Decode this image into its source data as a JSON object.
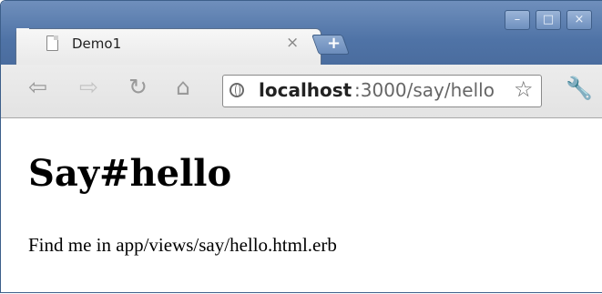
{
  "browser": {
    "tab": {
      "title": "Demo1",
      "close_glyph": "×"
    },
    "new_tab_glyph": "+",
    "window_buttons": {
      "minimize": "–",
      "maximize": "□",
      "close": "×"
    },
    "nav": {
      "back": "⇦",
      "forward": "⇨",
      "reload": "↻",
      "home": "⌂"
    },
    "address": {
      "host": "localhost",
      "path": ":3000/say/hello",
      "icon": "globe-icon"
    },
    "bookmark_glyph": "☆",
    "menu_glyph": "🔧"
  },
  "page": {
    "heading": "Say#hello",
    "text": "Find me in app/views/say/hello.html.erb"
  }
}
